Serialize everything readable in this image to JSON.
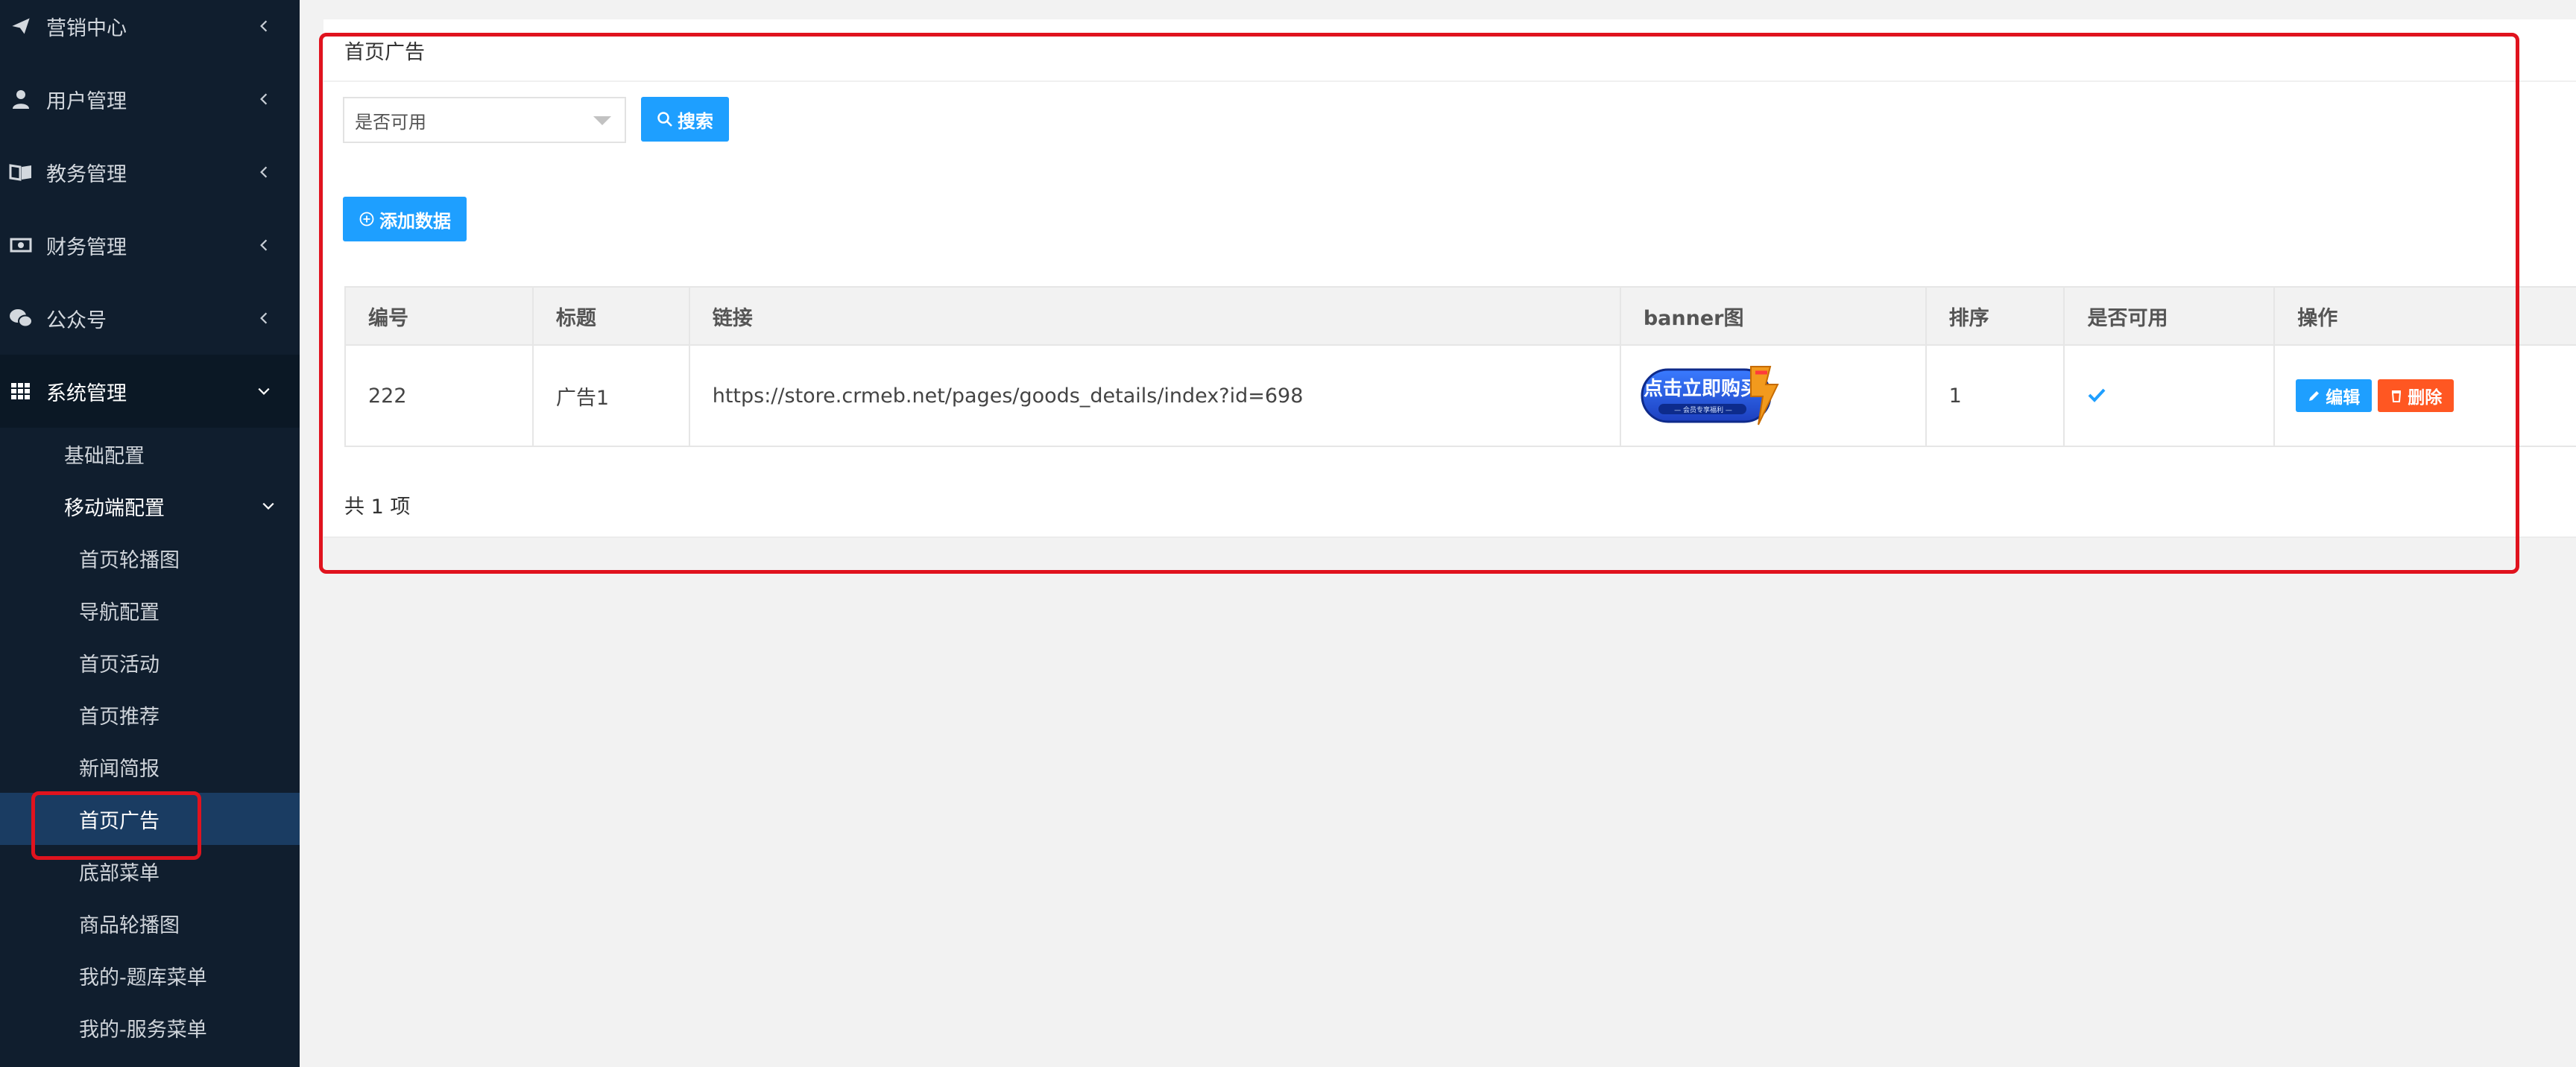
{
  "sidebar": {
    "menu": [
      {
        "label": "营销中心",
        "icon": "paper-plane-icon"
      },
      {
        "label": "用户管理",
        "icon": "user-icon"
      },
      {
        "label": "教务管理",
        "icon": "book-icon"
      },
      {
        "label": "财务管理",
        "icon": "money-icon"
      },
      {
        "label": "公众号",
        "icon": "wechat-icon"
      },
      {
        "label": "系统管理",
        "icon": "grid-icon"
      }
    ],
    "system_children": [
      {
        "label": "基础配置"
      },
      {
        "label": "移动端配置"
      }
    ],
    "mobile_children": [
      {
        "label": "首页轮播图"
      },
      {
        "label": "导航配置"
      },
      {
        "label": "首页活动"
      },
      {
        "label": "首页推荐"
      },
      {
        "label": "新闻简报"
      },
      {
        "label": "首页广告"
      },
      {
        "label": "底部菜单"
      },
      {
        "label": "商品轮播图"
      },
      {
        "label": "我的-题库菜单"
      },
      {
        "label": "我的-服务菜单"
      }
    ],
    "selected": "首页广告"
  },
  "panel": {
    "title": "首页广告",
    "filter": {
      "placeholder": "是否可用"
    },
    "search_label": "搜索",
    "add_label": "添加数据",
    "table": {
      "headers": [
        "编号",
        "标题",
        "链接",
        "banner图",
        "排序",
        "是否可用",
        "操作"
      ],
      "rows": [
        {
          "id": "222",
          "title": "广告1",
          "link": "https://store.crmeb.net/pages/goods_details/index?id=698",
          "banner_text": "点击立即购买",
          "banner_sub": "— 会员专享福利 —",
          "sort": "1",
          "enabled": true,
          "edit_label": "编辑",
          "delete_label": "删除"
        }
      ]
    },
    "total": "共 1 项"
  },
  "colors": {
    "sidebar_bg": "#101e2e",
    "selected_bg": "#1a3c62",
    "primary": "#1e9fff",
    "danger": "#ff5722",
    "annotation": "#e0131e"
  }
}
